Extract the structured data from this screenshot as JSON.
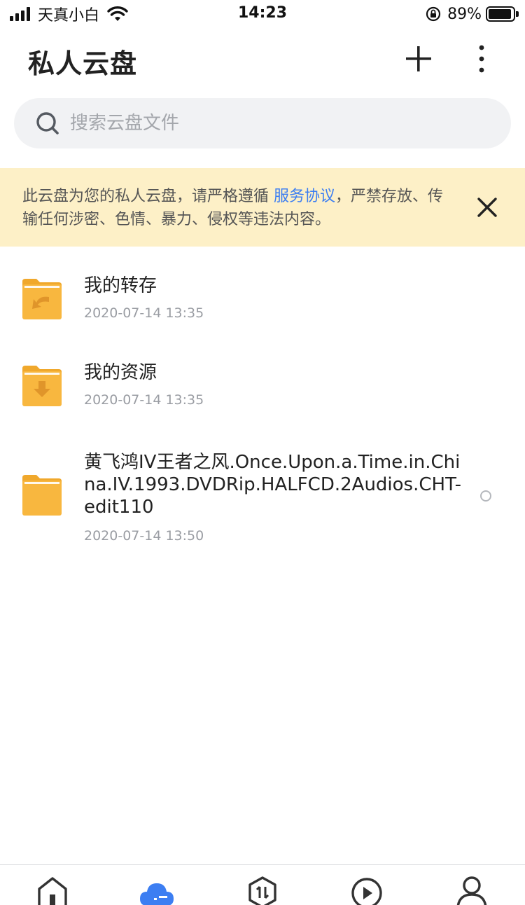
{
  "status_bar": {
    "carrier": "天真小白",
    "time": "14:23",
    "battery_percent": "89%"
  },
  "header": {
    "title": "私人云盘",
    "add_icon": "plus-icon",
    "more_icon": "more-vertical-icon"
  },
  "search": {
    "placeholder": "搜索云盘文件",
    "icon": "search-icon"
  },
  "notice": {
    "text_before": "此云盘为您的私人云盘，请严格遵循 ",
    "link": "服务协议",
    "text_after": "，严禁存放、传输任何涉密、色情、暴力、侵权等违法内容。",
    "close_icon": "close-icon"
  },
  "files": [
    {
      "name": "我的转存",
      "date": "2020-07-14 13:35",
      "icon": "folder-transfer-icon"
    },
    {
      "name": "我的资源",
      "date": "2020-07-14 13:35",
      "icon": "folder-download-icon"
    },
    {
      "name": "黄飞鸿IV王者之风.Once.Upon.a.Time.in.China.IV.1993.DVDRip.HALFCD.2Audios.CHT-edit110",
      "date": "2020-07-14 13:50",
      "icon": "folder-icon"
    }
  ],
  "tab_bar": {
    "tabs": [
      {
        "icon": "home-icon"
      },
      {
        "icon": "cloud-icon",
        "active": true
      },
      {
        "icon": "transfer-icon"
      },
      {
        "icon": "play-icon"
      },
      {
        "icon": "profile-icon"
      }
    ]
  },
  "colors": {
    "accent": "#3c7ef2",
    "folder": "#f8b73f",
    "notice_bg": "#fdf0c7",
    "search_bg": "#f1f2f4"
  }
}
